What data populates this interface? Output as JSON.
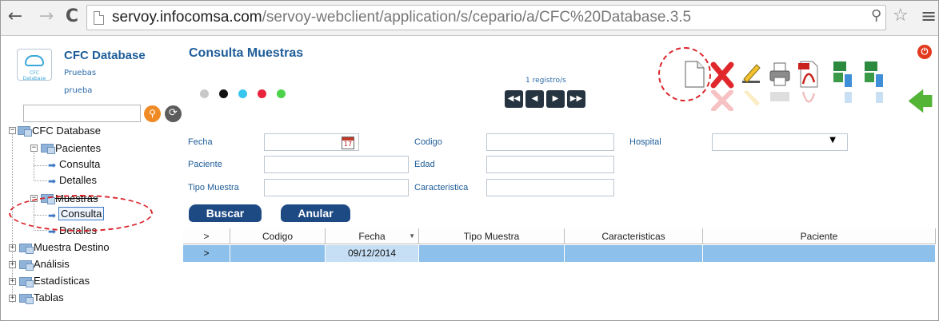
{
  "browser": {
    "back_glyph": "←",
    "forward_glyph": "→",
    "reload_glyph": "C",
    "url_host": "servoy.infocomsa.com",
    "url_path": "/servoy-webclient/application/s/cepario/a/CFC%20Database.3.5",
    "key_glyph": "⚲",
    "star_glyph": "☆",
    "menu_glyph": "≡"
  },
  "app": {
    "logo_label": "CFC Database",
    "title": "CFC Database",
    "subtitle1": "Pruebas",
    "subtitle2": "prueba",
    "search_value": "",
    "search_glyph": "⚲",
    "refresh_glyph": "⟳"
  },
  "tree": {
    "root": "CFC Database",
    "pacientes": "Pacientes",
    "pacientes_consulta": "Consulta",
    "pacientes_detalles": "Detalles",
    "muestras": "Muestras",
    "muestras_consulta": "Consulta",
    "muestras_detalles": "Detalles",
    "muestra_destino": "Muestra Destino",
    "analisis": "Análisis",
    "estadisticas": "Estadísticas",
    "tablas": "Tablas",
    "minus": "−",
    "plus": "+",
    "arrow": "➡"
  },
  "form": {
    "title": "Consulta Muestras",
    "record_count": "1 registro/s",
    "nav": {
      "first": "◀◀",
      "prev": "◀",
      "next": "▶",
      "last": "▶▶"
    },
    "status_dots": [
      "#c8c8c8",
      "#111111",
      "#37c6ef",
      "#e8243c",
      "#4cd34b"
    ],
    "labels": {
      "fecha": "Fecha",
      "codigo": "Codigo",
      "hospital": "Hospital",
      "paciente": "Paciente",
      "edad": "Edad",
      "tipo_muestra": "Tipo Muestra",
      "caracteristica": "Caracteristica"
    },
    "values": {
      "fecha": "",
      "codigo": "",
      "hospital": "",
      "paciente": "",
      "edad": "",
      "tipo_muestra": "",
      "caracteristica": ""
    },
    "calendar_day": "17",
    "buttons": {
      "buscar": "Buscar",
      "anular": "Anular"
    },
    "power_glyph": "⏻",
    "back_arrow_glyph": "🡄"
  },
  "grid": {
    "columns": [
      ">",
      "Codigo",
      "Fecha",
      "Tipo Muestra",
      "Caracteristicas",
      "Paciente"
    ],
    "rows": [
      [
        ">",
        "",
        "09/12/2014",
        "",
        "",
        ""
      ]
    ]
  },
  "colors": {
    "accent": "#1f5d99",
    "selected_row": "#8ec0ec",
    "annotation": "#d9242a"
  }
}
